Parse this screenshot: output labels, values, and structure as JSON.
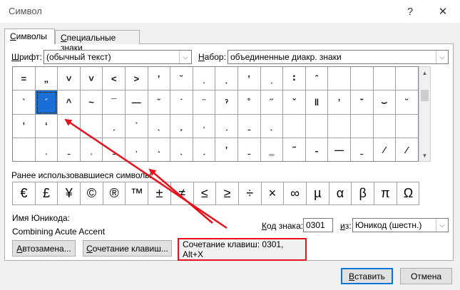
{
  "window": {
    "title": "Символ",
    "help": "?",
    "close": "✕"
  },
  "tabs": [
    {
      "label_u": "С",
      "label_rest": "имволы"
    },
    {
      "label_u": "С",
      "label_rest": "пециальные знаки"
    }
  ],
  "font": {
    "label_u": "Ш",
    "label_rest": "рифт:",
    "value": "(обычный текст)"
  },
  "subset": {
    "label_u": "Н",
    "label_rest": "абор:",
    "value": "объединенные диакр. знаки"
  },
  "grid": {
    "rows": [
      [
        "=",
        "„",
        "˅",
        "˅",
        "˂",
        "˃",
        "ʽ",
        "˘",
        "ˌ",
        "ˎ",
        "ʽ",
        "˯",
        "∶",
        "ˆ",
        "",
        "",
        "",
        ""
      ],
      [
        "`",
        "´",
        "^",
        "~",
        "¯",
        "—",
        "˘",
        "˙",
        "¨",
        "ˀ",
        "˚",
        "˝",
        "ˇ",
        "‖",
        "ʼ",
        "̆̇",
        "⌣",
        "˘"
      ],
      [
        "ʼ",
        "ʻ",
        "ʼ",
        "",
        "ˏ",
        "ˋ",
        "ˎ",
        "¸",
        "˒",
        "ˏ",
        "ˍ",
        "ˎ",
        "",
        "",
        "",
        "",
        "",
        ""
      ],
      [
        "",
        "ˌ",
        "ˍ",
        "ˌ",
        "ˍ",
        "˓",
        "˔",
        "ˎ",
        "ˏ",
        "ʽ",
        "ˍ",
        "‗",
        "˜",
        "˗",
        "—",
        "ˍ",
        "∕",
        "∕"
      ]
    ]
  },
  "recent": {
    "label": "Ранее использовавшиеся символы:",
    "items": [
      "€",
      "£",
      "¥",
      "©",
      "®",
      "™",
      "±",
      "≠",
      "≤",
      "≥",
      "÷",
      "×",
      "∞",
      "µ",
      "α",
      "β",
      "π",
      "Ω",
      "∑"
    ]
  },
  "unicode_name": {
    "label": "Имя Юникода:",
    "value": "Combining Acute Accent"
  },
  "char_code": {
    "label_u": "К",
    "label_rest": "од знака:",
    "value": "0301"
  },
  "from": {
    "label_u": "и",
    "label_rest": "з:",
    "value": "Юникод (шестн.)"
  },
  "buttons": {
    "autocorrect_u": "А",
    "autocorrect_rest": "втозамена...",
    "shortcut_u": "С",
    "shortcut_rest": "очетание клавиш...",
    "insert_u": "В",
    "insert_rest": "ставить",
    "cancel": "Отмена"
  },
  "shortcut_text": "Сочетание клавиш: 0301, Alt+X",
  "colors": {
    "selection": "#1a6fd6",
    "highlight": "#e8101a",
    "accent": "#0078d7"
  }
}
